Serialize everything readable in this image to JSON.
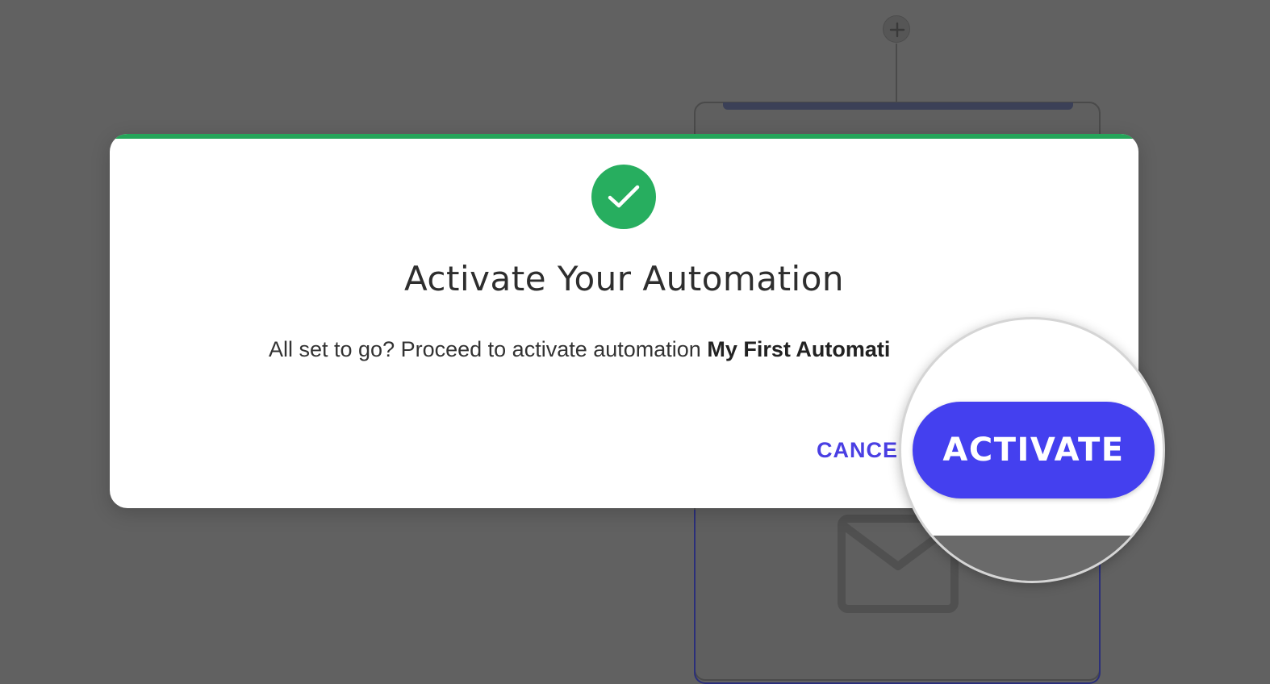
{
  "background": {
    "add_node_icon": "plus-icon",
    "card_icon": "mail-icon"
  },
  "modal": {
    "accent_color": "#25a55a",
    "icon": "checkmark-icon",
    "title": "Activate Your Automation",
    "message_prefix": "All set to go? Proceed to activate automation ",
    "automation_name": "My First Automati",
    "cancel_label": "CANCEL",
    "activate_label": "ACTIVATE",
    "button_color": "#4440ef"
  }
}
